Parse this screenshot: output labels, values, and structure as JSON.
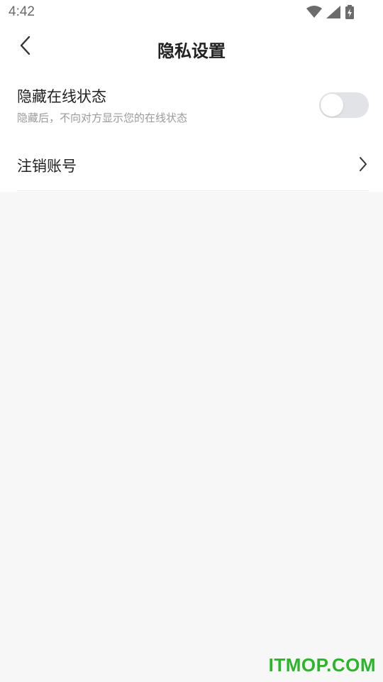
{
  "status_bar": {
    "time": "4:42",
    "icons": [
      "wifi-icon",
      "cell-signal-icon",
      "battery-charging-icon"
    ]
  },
  "header": {
    "title": "隐私设置",
    "back_icon": "chevron-left-icon"
  },
  "settings": {
    "online_status": {
      "title": "隐藏在线状态",
      "subtitle": "隐藏后，不向对方显示您的在线状态",
      "enabled": false
    },
    "cancel_account": {
      "label": "注销账号",
      "icon": "chevron-right-icon"
    }
  },
  "watermark": "ITMOP.COM",
  "colors": {
    "toggle_off": "#e1e3e7",
    "background": "#f7f7f7",
    "watermark": "#2bb52b"
  }
}
